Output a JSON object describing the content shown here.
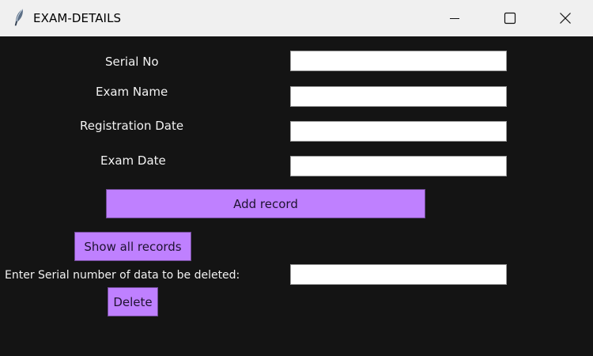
{
  "window": {
    "title": "EXAM-DETAILS"
  },
  "form": {
    "serial_no_label": "Serial No",
    "exam_name_label": "Exam Name",
    "registration_date_label": "Registration Date",
    "exam_date_label": "Exam Date",
    "serial_no_value": "",
    "exam_name_value": "",
    "registration_date_value": "",
    "exam_date_value": ""
  },
  "actions": {
    "add_record_label": "Add record",
    "show_all_records_label": "Show all records",
    "delete_prompt_label": "Enter Serial number of data to be deleted:",
    "delete_serial_value": "",
    "delete_label": "Delete"
  },
  "icons": {
    "app": "feather-icon",
    "minimize": "minimize-icon",
    "maximize": "maximize-icon",
    "close": "close-icon"
  },
  "colors": {
    "background": "#141414",
    "titlebar": "#f0f0f0",
    "button_accent": "#bf80ff",
    "text": "#f2f2f2"
  }
}
